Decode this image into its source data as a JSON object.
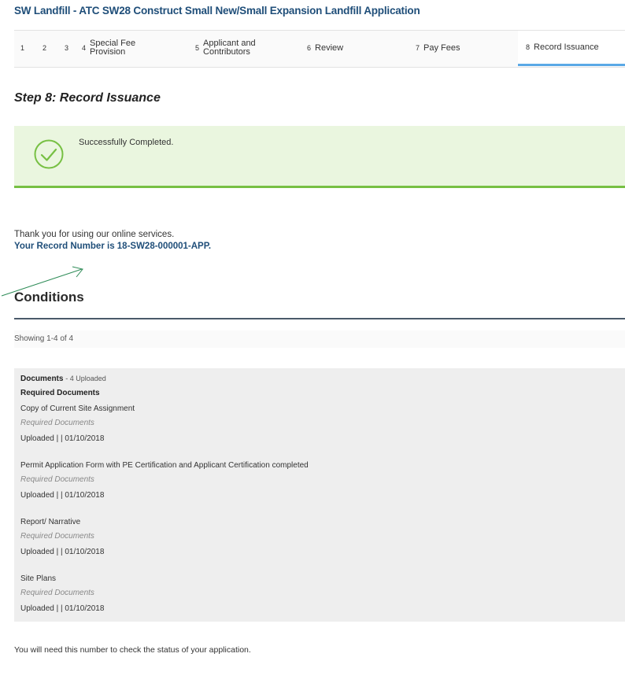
{
  "header": {
    "title": "SW Landfill - ATC SW28 Construct Small New/Small Expansion Landfill Application"
  },
  "steps": [
    {
      "num": "1",
      "label": ""
    },
    {
      "num": "2",
      "label": ""
    },
    {
      "num": "3",
      "label": ""
    },
    {
      "num": "4",
      "label_line1": "Special Fee",
      "label_line2": "Provision"
    },
    {
      "num": "5",
      "label_line1": "Applicant and",
      "label_line2": "Contributors"
    },
    {
      "num": "6",
      "label": "Review"
    },
    {
      "num": "7",
      "label": "Pay Fees"
    },
    {
      "num": "8",
      "label": "Record Issuance"
    }
  ],
  "step_heading": "Step 8: Record Issuance",
  "success": {
    "message": "Successfully Completed.",
    "icon": "check-circle-icon",
    "color": "#77c043"
  },
  "thanks_text": "Thank you for using our online services.",
  "record_text": "Your Record Number is 18-SW28-000001-APP.",
  "conditions": {
    "title": "Conditions",
    "showing": "Showing 1-4 of 4"
  },
  "documents": {
    "label": "Documents",
    "count_text": "- 4 Uploaded",
    "section_title": "Required Documents",
    "items": [
      {
        "name": "Copy of Current Site Assignment",
        "category": "Required Documents",
        "status": "Uploaded | | 01/10/2018"
      },
      {
        "name": "Permit Application Form with PE Certification and Applicant Certification completed",
        "category": "Required Documents",
        "status": "Uploaded | | 01/10/2018"
      },
      {
        "name": "Report/ Narrative",
        "category": "Required Documents",
        "status": "Uploaded | | 01/10/2018"
      },
      {
        "name": "Site Plans",
        "category": "Required Documents",
        "status": "Uploaded | | 01/10/2018"
      }
    ]
  },
  "footer_note": "You will need this number to check the status of your application."
}
